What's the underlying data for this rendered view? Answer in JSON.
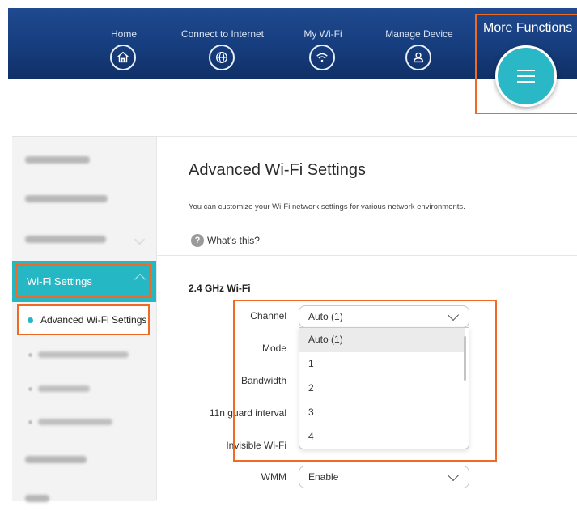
{
  "nav": {
    "items": [
      {
        "label": "Home",
        "icon": "home-icon"
      },
      {
        "label": "Connect to Internet",
        "icon": "globe-icon"
      },
      {
        "label": "My Wi-Fi",
        "icon": "wifi-icon"
      },
      {
        "label": "Manage Device",
        "icon": "user-icon"
      }
    ],
    "more_functions": "More Functions",
    "more_icon": "hamburger-menu-icon"
  },
  "sidebar": {
    "wifi_settings": "Wi-Fi Settings",
    "advanced": "Advanced Wi-Fi Settings"
  },
  "main": {
    "title": "Advanced Wi-Fi Settings",
    "description": "You can customize your Wi-Fi network settings for various network environments.",
    "help_link": "What's this?",
    "help_icon": "?",
    "section_title": "2.4 GHz Wi-Fi",
    "fields": {
      "channel": {
        "label": "Channel",
        "value": "Auto (1)"
      },
      "mode": {
        "label": "Mode"
      },
      "bandwidth": {
        "label": "Bandwidth"
      },
      "guard": {
        "label": "11n guard interval"
      },
      "invisible": {
        "label": "Invisible Wi-Fi"
      },
      "wmm": {
        "label": "WMM",
        "value": "Enable"
      }
    },
    "channel_options": [
      "Auto (1)",
      "1",
      "2",
      "3",
      "4"
    ]
  },
  "colors": {
    "accent": "#26b7c4",
    "highlight": "#ee6a25",
    "nav_bg": "#163d7d"
  }
}
